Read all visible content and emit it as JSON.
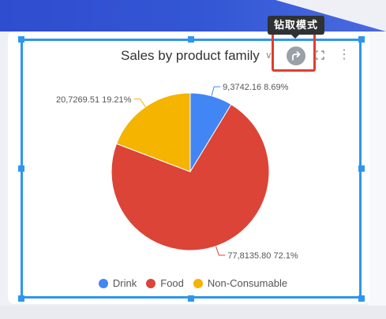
{
  "toolbar": {
    "tooltip": "钻取模式",
    "drill_icon": "redo-arrow-icon",
    "fullscreen_icon": "fullscreen-icon",
    "more_icon": "more-vertical-icon",
    "title_dropdown_icon": "chevron-down-icon"
  },
  "colors": {
    "selection": "#2e96ee",
    "highlight": "#e23c2c",
    "drink": "#4285f4",
    "food": "#db4437",
    "non_consumable": "#f4b400"
  },
  "chart_data": {
    "type": "pie",
    "title": "Sales by product family",
    "categories": [
      "Drink",
      "Food",
      "Non-Consumable"
    ],
    "values": [
      93742.16,
      778135.8,
      207269.51
    ],
    "value_labels": [
      "9,3742.16",
      "77,8135.80",
      "20,7269.51"
    ],
    "percent_labels": [
      "8.69%",
      "72.1%",
      "19.21%"
    ],
    "colors": [
      "#4285f4",
      "#db4437",
      "#f4b400"
    ],
    "legend_position": "bottom",
    "start_angle": "12 o'clock, clockwise"
  }
}
